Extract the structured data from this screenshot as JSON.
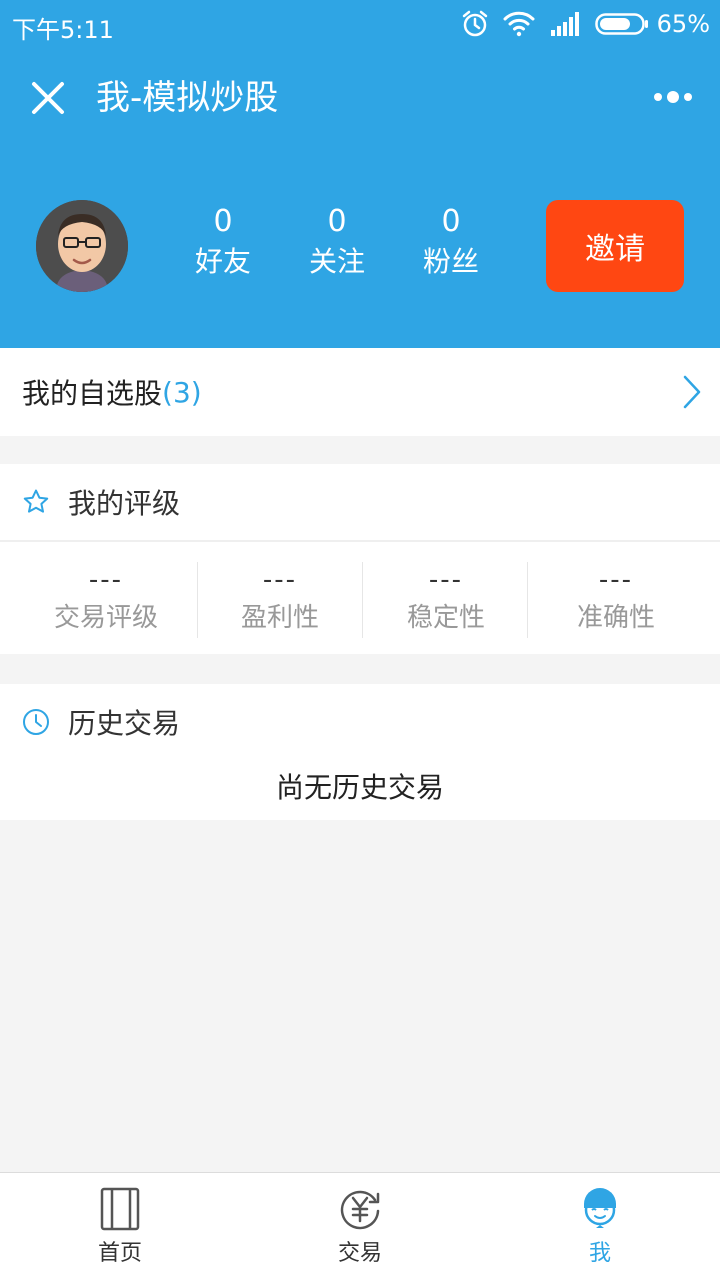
{
  "status_bar": {
    "time": "下午5:11",
    "battery": "65%",
    "icons": [
      "alarm-icon",
      "wifi-icon",
      "signal-icon",
      "battery-icon"
    ]
  },
  "nav": {
    "title": "我-模拟炒股"
  },
  "profile": {
    "stats": [
      {
        "value": "0",
        "label": "好友"
      },
      {
        "value": "0",
        "label": "关注"
      },
      {
        "value": "0",
        "label": "粉丝"
      }
    ],
    "invite_label": "邀请"
  },
  "watchlist": {
    "label": "我的自选股",
    "count": "(3)"
  },
  "rating": {
    "title": "我的评级",
    "items": [
      {
        "value": "---",
        "label": "交易评级"
      },
      {
        "value": "---",
        "label": "盈利性"
      },
      {
        "value": "---",
        "label": "稳定性"
      },
      {
        "value": "---",
        "label": "准确性"
      }
    ]
  },
  "history": {
    "title": "历史交易",
    "empty_text": "尚无历史交易"
  },
  "tabs": [
    {
      "label": "首页",
      "icon": "book-icon",
      "active": false
    },
    {
      "label": "交易",
      "icon": "yuan-exchange-icon",
      "active": false
    },
    {
      "label": "我",
      "icon": "person-icon",
      "active": true
    }
  ],
  "colors": {
    "brand_blue": "#2fa5e4",
    "invite_orange": "#ff4712",
    "background": "#f4f4f4"
  }
}
